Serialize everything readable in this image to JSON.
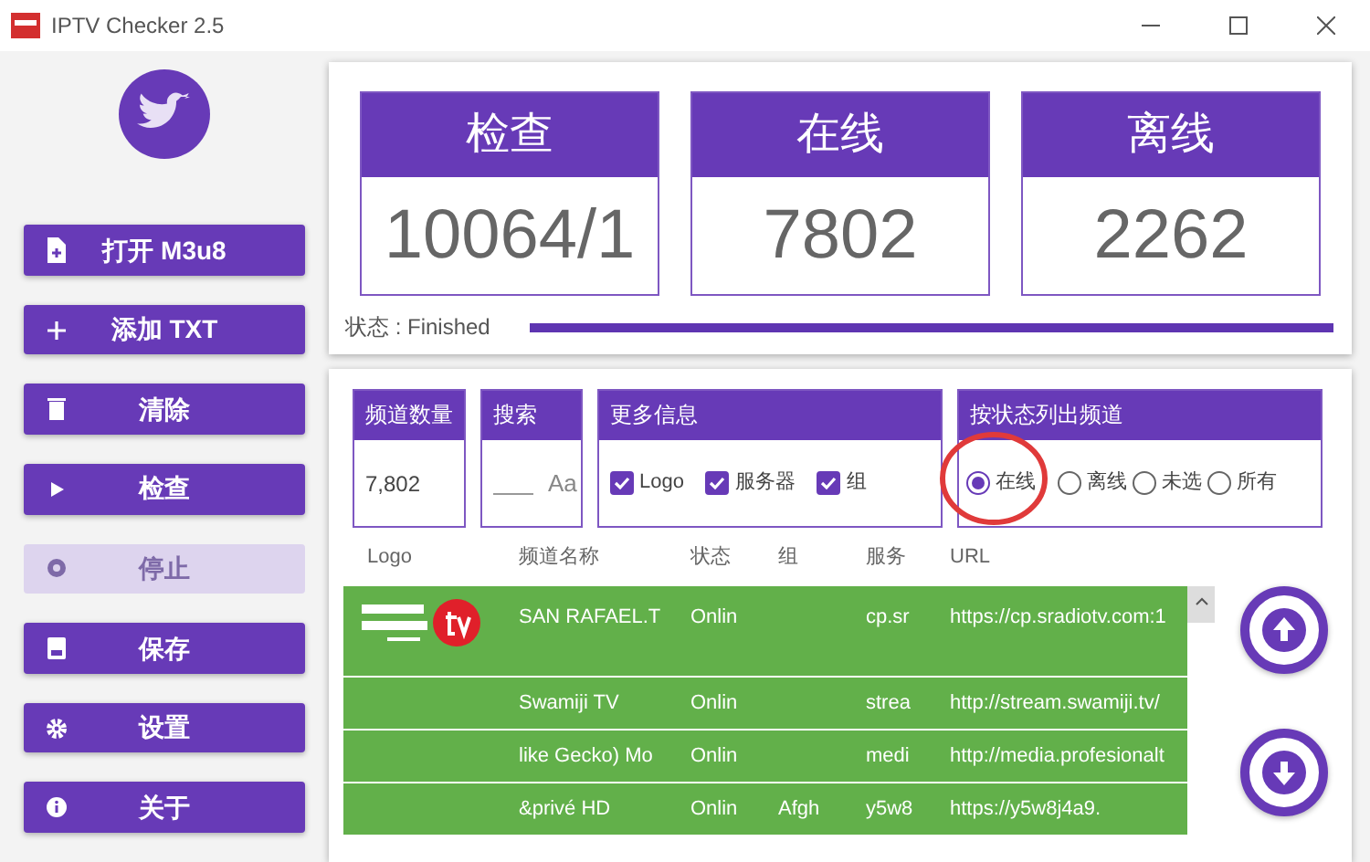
{
  "window": {
    "title": "IPTV Checker 2.5"
  },
  "sidebar": {
    "buttons": [
      {
        "label": "打开 M3u8",
        "disabled": false
      },
      {
        "label": "添加 TXT",
        "disabled": false
      },
      {
        "label": "清除",
        "disabled": false
      },
      {
        "label": "检查",
        "disabled": false
      },
      {
        "label": "停止",
        "disabled": true
      },
      {
        "label": "保存",
        "disabled": false
      },
      {
        "label": "设置",
        "disabled": false
      },
      {
        "label": "关于",
        "disabled": false
      }
    ]
  },
  "stats": [
    {
      "title": "检查",
      "value": "10064/1"
    },
    {
      "title": "在线",
      "value": "7802"
    },
    {
      "title": "离线",
      "value": "2262"
    }
  ],
  "status": {
    "label": "状态 : Finished",
    "level": 1
  },
  "filters": {
    "channel_count": {
      "title": "频道数量",
      "value": "7,802"
    },
    "search": {
      "title": "搜索",
      "match_case": "Aa"
    },
    "more_info": {
      "title": "更多信息",
      "options": [
        {
          "label": "Logo",
          "checked": true
        },
        {
          "label": "服务器",
          "checked": true
        },
        {
          "label": "组",
          "checked": true
        }
      ]
    },
    "list_by_status": {
      "title": "按状态列出频道",
      "options": [
        {
          "label": "在线",
          "selected": true
        },
        {
          "label": "离线",
          "selected": false
        },
        {
          "label": "未选",
          "selected": false
        },
        {
          "label": "所有",
          "selected": false
        }
      ]
    }
  },
  "table": {
    "columns": [
      "Logo",
      "频道名称",
      "状态",
      "组",
      "服务",
      "URL"
    ],
    "rows": [
      {
        "logo": true,
        "cells": [
          "",
          "SAN RAFAEL.T",
          "Onlin",
          "",
          "cp.sr",
          "https://cp.sradiotv.com:1"
        ]
      },
      {
        "logo": false,
        "cells": [
          "",
          "Swamiji TV",
          "Onlin",
          "",
          "strea",
          "http://stream.swamiji.tv/"
        ]
      },
      {
        "logo": false,
        "cells": [
          "",
          "like Gecko) Mo",
          "Onlin",
          "",
          "medi",
          "http://media.profesionalt"
        ]
      },
      {
        "logo": false,
        "cells": [
          "",
          "&privé HD",
          "Onlin",
          "Afgh",
          "y5w8",
          "https://y5w8j4a9."
        ]
      }
    ]
  }
}
